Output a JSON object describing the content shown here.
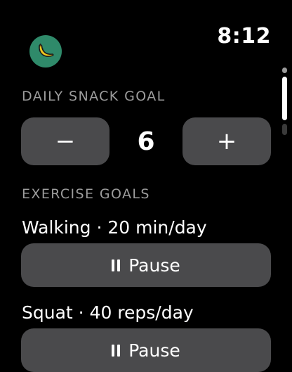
{
  "status": {
    "time": "8:12",
    "app_icon": "banana-icon",
    "app_icon_color": "#2f8a6a"
  },
  "snack_goal": {
    "header": "DAILY SNACK GOAL",
    "decrement_label": "−",
    "increment_label": "+",
    "value": "6"
  },
  "exercise_goals": {
    "header": "EXERCISE GOALS",
    "items": [
      {
        "label": "Walking · 20 min/day",
        "button_label": "Pause",
        "button_icon": "pause-icon"
      },
      {
        "label": "Squat · 40 reps/day",
        "button_label": "Pause",
        "button_icon": "pause-icon"
      }
    ]
  },
  "colors": {
    "background": "#000000",
    "button": "#4a4a4c",
    "header_text": "#9d9d9d"
  }
}
